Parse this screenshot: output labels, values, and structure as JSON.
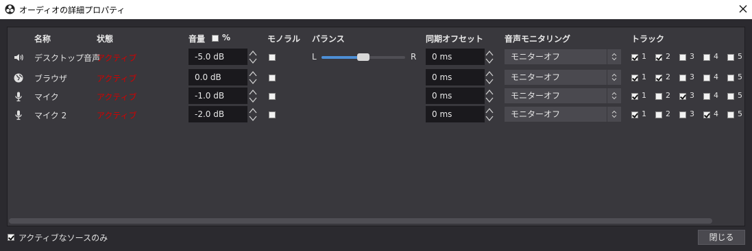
{
  "window": {
    "title": "オーディオの詳細プロパティ",
    "close_icon": "close-icon",
    "app_icon": "obs-icon"
  },
  "headers": {
    "name": "名称",
    "status": "状態",
    "volume": "音量",
    "percent": "%",
    "mono": "モノラル",
    "balance": "バランス",
    "sync_offset": "同期オフセット",
    "monitoring": "音声モニタリング",
    "tracks": "トラック"
  },
  "sources": [
    {
      "icon": "speaker-icon",
      "name": "デスクトップ音声",
      "status": "アクティブ",
      "volume": "-5.0 dB",
      "mono": false,
      "balance": {
        "left": "L",
        "right": "R",
        "value": 0.5
      },
      "offset": "0 ms",
      "monitoring": "モニターオフ",
      "tracks": [
        true,
        true,
        false,
        false,
        false
      ]
    },
    {
      "icon": "globe-icon",
      "name": "ブラウザ",
      "status": "アクティブ",
      "volume": "0.0 dB",
      "mono": false,
      "offset": "0 ms",
      "monitoring": "モニターオフ",
      "tracks": [
        true,
        true,
        false,
        false,
        false
      ]
    },
    {
      "icon": "microphone-icon",
      "name": "マイク",
      "status": "アクティブ",
      "volume": "-1.0 dB",
      "mono": false,
      "offset": "0 ms",
      "monitoring": "モニターオフ",
      "tracks": [
        true,
        false,
        true,
        false,
        false
      ]
    },
    {
      "icon": "microphone-icon",
      "name": "マイク 2",
      "status": "アクティブ",
      "volume": "-2.0 dB",
      "mono": false,
      "offset": "0 ms",
      "monitoring": "モニターオフ",
      "tracks": [
        true,
        false,
        false,
        true,
        false
      ]
    }
  ],
  "track_labels": [
    "1",
    "2",
    "3",
    "4",
    "5"
  ],
  "footer": {
    "active_only_label": "アクティブなソースのみ",
    "active_only_checked": true,
    "close_label": "閉じる"
  },
  "colors": {
    "status_active": "#d40000",
    "slider_fill": "#4d8fd6"
  }
}
